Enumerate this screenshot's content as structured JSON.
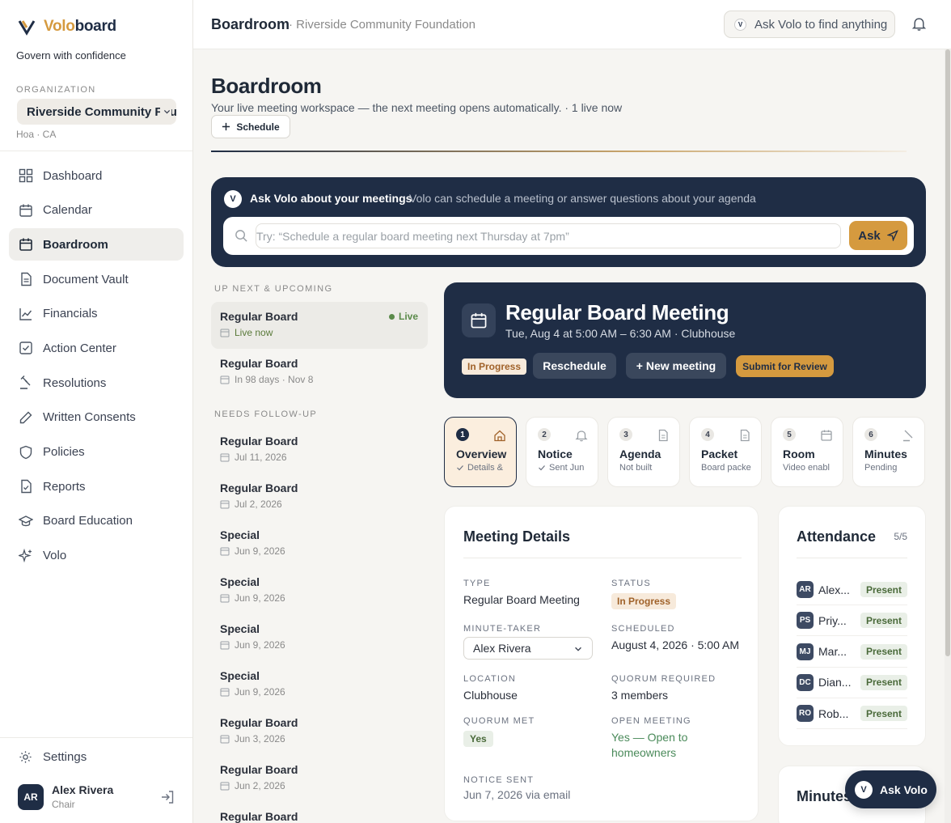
{
  "brand": {
    "name_a": "Volo",
    "name_b": "board",
    "tagline": "Govern with confidence"
  },
  "org": {
    "label": "ORGANIZATION",
    "name": "Riverside Community Foundation",
    "sub": "Hoa · CA"
  },
  "nav": [
    {
      "label": "Dashboard",
      "icon": "dashboard-icon"
    },
    {
      "label": "Calendar",
      "icon": "calendar-icon"
    },
    {
      "label": "Boardroom",
      "icon": "boardroom-icon",
      "active": true
    },
    {
      "label": "Document Vault",
      "icon": "document-icon"
    },
    {
      "label": "Financials",
      "icon": "chart-icon"
    },
    {
      "label": "Action Center",
      "icon": "check-square-icon"
    },
    {
      "label": "Resolutions",
      "icon": "gavel-icon"
    },
    {
      "label": "Written Consents",
      "icon": "pen-icon"
    },
    {
      "label": "Policies",
      "icon": "shield-icon"
    },
    {
      "label": "Reports",
      "icon": "report-icon"
    },
    {
      "label": "Board Education",
      "icon": "graduation-cap-icon"
    },
    {
      "label": "Volo",
      "icon": "sparkle-icon"
    }
  ],
  "settings_label": "Settings",
  "user": {
    "initials": "AR",
    "name": "Alex Rivera",
    "role": "Chair"
  },
  "topbar": {
    "crumb": "Boardroom",
    "crumb_org": "· Riverside Community Foundation",
    "search_badge": "V",
    "search_placeholder": "Ask Volo to find anything"
  },
  "page": {
    "title": "Boardroom",
    "subtitle": "Your live meeting workspace — the next meeting opens automatically. · 1 live now",
    "schedule_label": "Schedule"
  },
  "ask": {
    "badge": "V",
    "title": "Ask Volo about your meetings",
    "desc": "Volo can schedule a meeting or answer questions about your agenda",
    "placeholder": "Try: “Schedule a regular board meeting next Thursday at 7pm”",
    "button": "Ask"
  },
  "sections": {
    "upcoming": "UP NEXT & UPCOMING",
    "followup": "NEEDS FOLLOW-UP"
  },
  "upcoming": [
    {
      "title": "Regular Board",
      "date": "Live now",
      "live": "Live"
    },
    {
      "title": "Regular Board",
      "date": "In 98 days · Nov 8"
    }
  ],
  "followup": [
    {
      "title": "Regular Board",
      "date": "Jul 11, 2026"
    },
    {
      "title": "Regular Board",
      "date": "Jul 2, 2026"
    },
    {
      "title": "Special",
      "date": "Jun 9, 2026"
    },
    {
      "title": "Special",
      "date": "Jun 9, 2026"
    },
    {
      "title": "Special",
      "date": "Jun 9, 2026"
    },
    {
      "title": "Special",
      "date": "Jun 9, 2026"
    },
    {
      "title": "Regular Board",
      "date": "Jun 3, 2026"
    },
    {
      "title": "Regular Board",
      "date": "Jun 2, 2026"
    },
    {
      "title": "Regular Board",
      "date": ""
    }
  ],
  "hero": {
    "title": "Regular Board Meeting",
    "subtitle": "Tue, Aug 4 at 5:00 AM – 6:30 AM · Clubhouse",
    "status": "In Progress",
    "reschedule": "Reschedule",
    "new_meeting": "+ New meeting",
    "submit": "Submit for Review"
  },
  "steps": [
    {
      "num": "1",
      "label": "Overview",
      "sub": "Details &",
      "icon": "home-icon",
      "check": true
    },
    {
      "num": "2",
      "label": "Notice",
      "sub": "Sent Jun",
      "icon": "bell-icon",
      "check": true
    },
    {
      "num": "3",
      "label": "Agenda",
      "sub": "Not built",
      "icon": "file-icon"
    },
    {
      "num": "4",
      "label": "Packet",
      "sub": "Board packe",
      "icon": "file-icon"
    },
    {
      "num": "5",
      "label": "Room",
      "sub": "Video enabl",
      "icon": "calendar-icon"
    },
    {
      "num": "6",
      "label": "Minutes",
      "sub": "Pending",
      "icon": "gavel-icon"
    }
  ],
  "details": {
    "title": "Meeting Details",
    "type_label": "TYPE",
    "type": "Regular Board Meeting",
    "status_label": "STATUS",
    "status": "In Progress",
    "minute_taker_label": "MINUTE-TAKER",
    "minute_taker": "Alex Rivera",
    "scheduled_label": "SCHEDULED",
    "scheduled": "August 4, 2026 · 5:00 AM",
    "location_label": "LOCATION",
    "location": "Clubhouse",
    "quorum_req_label": "QUORUM REQUIRED",
    "quorum_req": "3 members",
    "quorum_met_label": "QUORUM MET",
    "quorum_met": "Yes",
    "open_label": "OPEN MEETING",
    "open": "Yes — Open to homeowners",
    "notice_label": "NOTICE SENT",
    "notice": "Jun 7, 2026 via email"
  },
  "attendance": {
    "title": "Attendance",
    "count": "5/5",
    "rows": [
      {
        "initials": "AR",
        "name": "Alex...",
        "status": "Present"
      },
      {
        "initials": "PS",
        "name": "Priy...",
        "status": "Present"
      },
      {
        "initials": "MJ",
        "name": "Mar...",
        "status": "Present"
      },
      {
        "initials": "DC",
        "name": "Dian...",
        "status": "Present"
      },
      {
        "initials": "RO",
        "name": "Rob...",
        "status": "Present"
      }
    ]
  },
  "minutes_title": "Minutes",
  "fab": {
    "badge": "V",
    "label": "Ask Volo"
  },
  "colors": {
    "navy": "#1f2d45",
    "gold": "#d59a3f",
    "green": "#4a8a5a"
  }
}
